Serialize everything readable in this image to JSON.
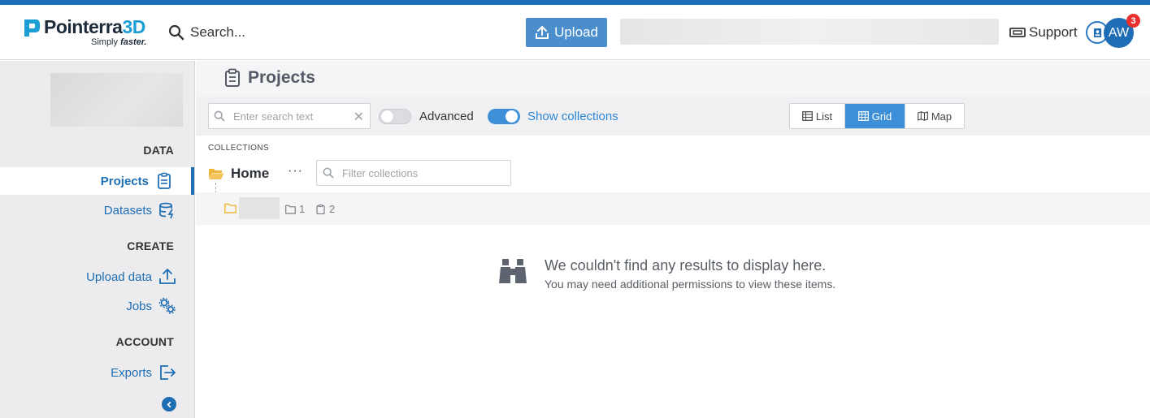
{
  "brand": {
    "name_main": "Pointerra",
    "name_accent": "3D",
    "tagline_prefix": "Simply ",
    "tagline_bold": "faster."
  },
  "header": {
    "search_label": "Search...",
    "upload_label": "Upload",
    "support_label": "Support",
    "avatar_initials": "AW",
    "notification_count": "3"
  },
  "sidebar": {
    "sections": {
      "data": "DATA",
      "create": "CREATE",
      "account": "ACCOUNT"
    },
    "items": {
      "projects": "Projects",
      "datasets": "Datasets",
      "upload_data": "Upload data",
      "jobs": "Jobs",
      "exports": "Exports"
    },
    "active": "projects"
  },
  "main": {
    "title": "Projects",
    "search_placeholder": "Enter search text",
    "advanced_label": "Advanced",
    "advanced_on": false,
    "show_collections_label": "Show collections",
    "show_collections_on": true,
    "views": [
      "List",
      "Grid",
      "Map"
    ],
    "active_view": "Grid",
    "collections_heading": "COLLECTIONS",
    "home_label": "Home",
    "more_label": "···",
    "filter_placeholder": "Filter collections",
    "collection_row": {
      "folders_count": "1",
      "projects_count": "2"
    },
    "empty_title": "We couldn't find any results to display here.",
    "empty_subtitle": "You may need additional permissions to view these items."
  },
  "colors": {
    "brand_blue": "#1e6eb4",
    "accent_blue": "#3d8fd8",
    "folder_yellow": "#f0b63b",
    "badge_red": "#e8312f"
  },
  "icons": [
    "search-icon",
    "upload-icon",
    "ticket-icon",
    "user-card-icon",
    "clipboard-icon",
    "database-bolt-icon",
    "upload-tray-icon",
    "gears-icon",
    "export-icon",
    "chevron-left-icon",
    "table-icon",
    "grid-icon",
    "map-icon",
    "folder-open-icon",
    "folder-icon",
    "binoculars-icon"
  ]
}
